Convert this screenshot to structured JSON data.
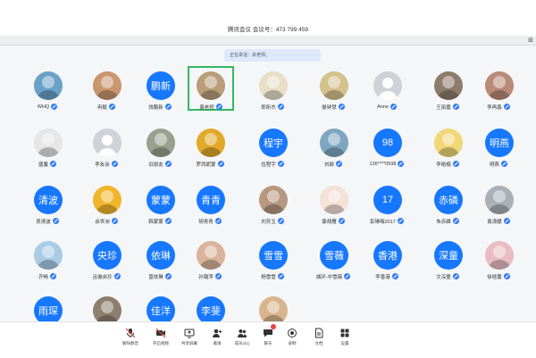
{
  "window": {
    "title": "腾讯会议 会议号：473 799 459",
    "corner_symbol": "⊞"
  },
  "speaking": {
    "text": "正在讲话：袁老师；"
  },
  "participants": [
    {
      "name": "WHQ",
      "avatar_type": "photo",
      "avatar_text": "",
      "icon": "winter-sports-avatar",
      "color": "#6aa1c8",
      "active": false
    },
    {
      "name": "冉懿",
      "avatar_type": "photo",
      "avatar_text": "",
      "icon": "girl-avatar",
      "color": "#c9966e",
      "active": false
    },
    {
      "name": "饶鹏新",
      "avatar_type": "text",
      "avatar_text": "鹏新",
      "icon": "",
      "color": "#1677ff",
      "active": false
    },
    {
      "name": "袁老师",
      "avatar_type": "photo",
      "avatar_text": "",
      "icon": "scenery-avatar",
      "color": "#b99d78",
      "active": true
    },
    {
      "name": "郎昕杰",
      "avatar_type": "photo",
      "avatar_text": "",
      "icon": "cartoon-avatar",
      "color": "#e9dfc9",
      "active": false
    },
    {
      "name": "晏钟慧",
      "avatar_type": "photo",
      "avatar_text": "",
      "icon": "cartoon-girl-avatar",
      "color": "#d4c28c",
      "active": false
    },
    {
      "name": "Anne",
      "avatar_type": "gray",
      "avatar_text": "",
      "icon": "default-user-avatar",
      "color": "#cfd3d8",
      "active": false
    },
    {
      "name": "王丽嘉",
      "avatar_type": "photo",
      "avatar_text": "",
      "icon": "room-avatar",
      "color": "#8d7b6b",
      "active": false
    },
    {
      "name": "李再鑫",
      "avatar_type": "photo",
      "avatar_text": "",
      "icon": "pet-avatar",
      "color": "#b88a78",
      "active": false
    },
    {
      "name": "盛馨",
      "avatar_type": "photo",
      "avatar_text": "",
      "icon": "anime-avatar",
      "color": "#e6e6e6",
      "active": false
    },
    {
      "name": "李友余",
      "avatar_type": "gray",
      "avatar_text": "",
      "icon": "default-user-avatar",
      "color": "#cfd3d8",
      "active": false
    },
    {
      "name": "旧朋友",
      "avatar_type": "photo",
      "avatar_text": "",
      "icon": "group-photo-avatar",
      "color": "#9aa08f",
      "active": false
    },
    {
      "name": "罗西妮蒙",
      "avatar_type": "photo",
      "avatar_text": "",
      "icon": "sunflower-avatar",
      "color": "#e1a928",
      "active": false
    },
    {
      "name": "伍程宇",
      "avatar_type": "text",
      "avatar_text": "程宇",
      "icon": "",
      "color": "#1677ff",
      "active": false
    },
    {
      "name": "刘颖",
      "avatar_type": "photo",
      "avatar_text": "",
      "icon": "illustration-avatar",
      "color": "#7fa6c1",
      "active": false
    },
    {
      "name": "136****0598",
      "avatar_type": "text",
      "avatar_text": "98",
      "icon": "",
      "color": "#1677ff",
      "active": false
    },
    {
      "name": "李皓楠",
      "avatar_type": "photo",
      "avatar_text": "",
      "icon": "yellow-cartoon-avatar",
      "color": "#f1d779",
      "active": false
    },
    {
      "name": "明燕",
      "avatar_type": "text",
      "avatar_text": "明燕",
      "icon": "",
      "color": "#1677ff",
      "active": false
    },
    {
      "name": "吴清波",
      "avatar_type": "text",
      "avatar_text": "清波",
      "icon": "",
      "color": "#1677ff",
      "active": false
    },
    {
      "name": "余世洲",
      "avatar_type": "photo",
      "avatar_text": "",
      "icon": "silhouette-avatar",
      "color": "#f0b62b",
      "active": false
    },
    {
      "name": "韩蒙蒙",
      "avatar_type": "text",
      "avatar_text": "蒙蒙",
      "icon": "",
      "color": "#1677ff",
      "active": false
    },
    {
      "name": "胡青青",
      "avatar_type": "text",
      "avatar_text": "青青",
      "icon": "",
      "color": "#1677ff",
      "active": false
    },
    {
      "name": "刘芳玉",
      "avatar_type": "photo",
      "avatar_text": "",
      "icon": "family-avatar",
      "color": "#b6977f",
      "active": false
    },
    {
      "name": "姜胡雁",
      "avatar_type": "photo",
      "avatar_text": "",
      "icon": "cartoon-bear-avatar",
      "color": "#f4e1d8",
      "active": false
    },
    {
      "name": "彭琳梅2017",
      "avatar_type": "text",
      "avatar_text": "17",
      "icon": "",
      "color": "#1677ff",
      "active": false
    },
    {
      "name": "朱赤磷",
      "avatar_type": "text",
      "avatar_text": "赤磷",
      "icon": "",
      "color": "#1677ff",
      "active": false
    },
    {
      "name": "袁潇媛",
      "avatar_type": "gray",
      "avatar_text": "",
      "icon": "gray-photo-avatar",
      "color": "#aab0b6",
      "active": false
    },
    {
      "name": "齐畅",
      "avatar_type": "photo",
      "avatar_text": "",
      "icon": "anime-girl-avatar",
      "color": "#a9cbe6",
      "active": false
    },
    {
      "name": "且璇央珍",
      "avatar_type": "text",
      "avatar_text": "央珍",
      "icon": "",
      "color": "#1677ff",
      "active": false
    },
    {
      "name": "曾依琳",
      "avatar_type": "text",
      "avatar_text": "依琳",
      "icon": "",
      "color": "#1677ff",
      "active": false
    },
    {
      "name": "孙璐萍",
      "avatar_type": "photo",
      "avatar_text": "",
      "icon": "girl-portrait-avatar",
      "color": "#d9b39b",
      "active": false
    },
    {
      "name": "杨雪雪",
      "avatar_type": "text",
      "avatar_text": "雪雪",
      "icon": "",
      "color": "#1677ff",
      "active": false
    },
    {
      "name": "城环-中雪薇",
      "avatar_type": "text",
      "avatar_text": "雪薇",
      "icon": "",
      "color": "#1677ff",
      "active": false
    },
    {
      "name": "李香港",
      "avatar_type": "text",
      "avatar_text": "香港",
      "icon": "",
      "color": "#1677ff",
      "active": false
    },
    {
      "name": "文深童",
      "avatar_type": "text",
      "avatar_text": "深童",
      "icon": "",
      "color": "#1677ff",
      "active": false
    },
    {
      "name": "徐晗蔓",
      "avatar_type": "photo",
      "avatar_text": "",
      "icon": "pink-illustration-avatar",
      "color": "#e8bcc4",
      "active": false
    },
    {
      "name": "",
      "avatar_type": "text",
      "avatar_text": "雨琛",
      "icon": "",
      "color": "#1677ff",
      "active": false
    },
    {
      "name": "",
      "avatar_type": "photo",
      "avatar_text": "",
      "icon": "group-avatar",
      "color": "#8e7e70",
      "active": false
    },
    {
      "name": "",
      "avatar_type": "text",
      "avatar_text": "佳洋",
      "icon": "",
      "color": "#1677ff",
      "active": false
    },
    {
      "name": "",
      "avatar_type": "text",
      "avatar_text": "李斐",
      "icon": "",
      "color": "#1677ff",
      "active": false
    },
    {
      "name": "",
      "avatar_type": "photo",
      "avatar_text": "",
      "icon": "dog-avatar",
      "color": "#d8b48d",
      "active": false
    }
  ],
  "toolbar": [
    {
      "label": "解除静音",
      "icon": "muted-mic-icon",
      "badge": false
    },
    {
      "label": "开启视频",
      "icon": "video-off-icon",
      "badge": false
    },
    {
      "label": "共享屏幕",
      "icon": "share-screen-icon",
      "badge": false
    },
    {
      "label": "邀请",
      "icon": "invite-icon",
      "badge": false
    },
    {
      "label": "成员(41)",
      "icon": "members-icon",
      "badge": false
    },
    {
      "label": "聊天",
      "icon": "chat-icon",
      "badge": true
    },
    {
      "label": "录制",
      "icon": "record-icon",
      "badge": false
    },
    {
      "label": "文档",
      "icon": "document-icon",
      "badge": false
    },
    {
      "label": "设置",
      "icon": "settings-icon",
      "badge": false
    }
  ]
}
